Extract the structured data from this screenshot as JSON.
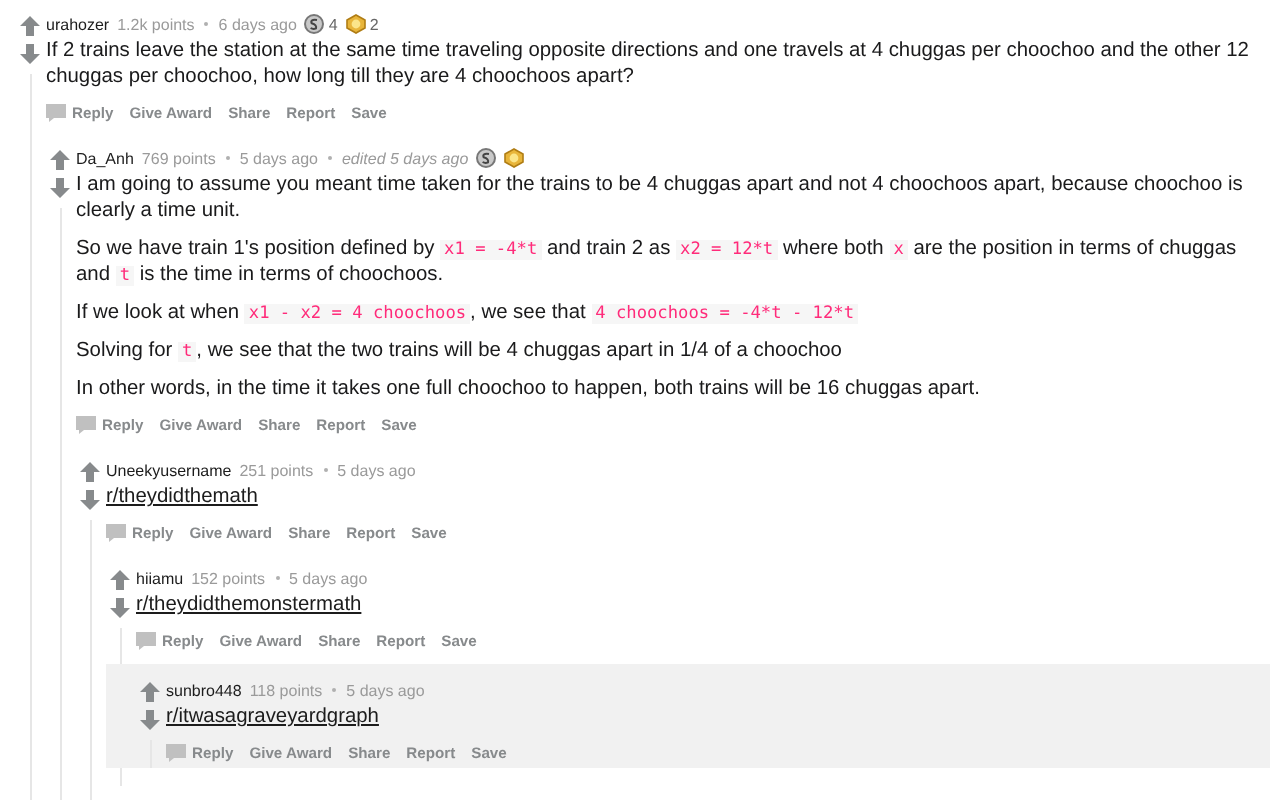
{
  "comments": [
    {
      "author": "urahozer",
      "points": "1.2k points",
      "time": "6 days ago",
      "highlighted": false,
      "awards": [
        {
          "kind": "silver",
          "count": "4"
        },
        {
          "kind": "gold",
          "count": "2"
        }
      ],
      "paragraphs": [
        [
          {
            "kind": "text",
            "text": "If 2 trains leave the station at the same time traveling opposite directions and one travels at 4 chuggas per choochoo and the other 12 chuggas per choochoo, how long till they are 4 choochoos apart?"
          }
        ]
      ],
      "actions": [
        {
          "kind": "reply",
          "label": "Reply"
        },
        {
          "kind": "plain",
          "label": "Give Award"
        },
        {
          "kind": "plain",
          "label": "Share"
        },
        {
          "kind": "plain",
          "label": "Report"
        },
        {
          "kind": "plain",
          "label": "Save"
        }
      ],
      "children": [
        {
          "author": "Da_Anh",
          "points": "769 points",
          "time": "5 days ago",
          "edited": "edited 5 days ago",
          "highlighted": false,
          "awards": [
            {
              "kind": "silver"
            },
            {
              "kind": "gold"
            }
          ],
          "paragraphs": [
            [
              {
                "kind": "text",
                "text": "I am going to assume you meant time taken for the trains to be 4 chuggas apart and not 4 choochoos apart, because choochoo is clearly a time unit."
              }
            ],
            [
              {
                "kind": "text",
                "text": "So we have train 1's position defined by "
              },
              {
                "kind": "code",
                "text": "x1 = -4*t"
              },
              {
                "kind": "text",
                "text": " and train 2 as "
              },
              {
                "kind": "code",
                "text": "x2 = 12*t"
              },
              {
                "kind": "text",
                "text": " where both "
              },
              {
                "kind": "code",
                "text": "x"
              },
              {
                "kind": "text",
                "text": " are the position in terms of chuggas and "
              },
              {
                "kind": "code",
                "text": "t"
              },
              {
                "kind": "text",
                "text": " is the time in terms of choochoos."
              }
            ],
            [
              {
                "kind": "text",
                "text": "If we look at when "
              },
              {
                "kind": "code",
                "text": "x1 - x2 = 4 choochoos"
              },
              {
                "kind": "text",
                "text": ", we see that "
              },
              {
                "kind": "code",
                "text": "4 choochoos = -4*t - 12*t"
              }
            ],
            [
              {
                "kind": "text",
                "text": "Solving for "
              },
              {
                "kind": "code",
                "text": "t"
              },
              {
                "kind": "text",
                "text": ", we see that the two trains will be 4 chuggas apart in 1/4 of a choochoo"
              }
            ],
            [
              {
                "kind": "text",
                "text": "In other words, in the time it takes one full choochoo to happen, both trains will be 16 chuggas apart."
              }
            ]
          ],
          "actions": [
            {
              "kind": "reply",
              "label": "Reply"
            },
            {
              "kind": "plain",
              "label": "Give Award"
            },
            {
              "kind": "plain",
              "label": "Share"
            },
            {
              "kind": "plain",
              "label": "Report"
            },
            {
              "kind": "plain",
              "label": "Save"
            }
          ],
          "children": [
            {
              "author": "Uneekyusername",
              "points": "251 points",
              "time": "5 days ago",
              "highlighted": false,
              "paragraphs": [
                [
                  {
                    "kind": "link",
                    "text": "r/theydidthemath"
                  }
                ]
              ],
              "actions": [
                {
                  "kind": "reply",
                  "label": "Reply"
                },
                {
                  "kind": "plain",
                  "label": "Give Award"
                },
                {
                  "kind": "plain",
                  "label": "Share"
                },
                {
                  "kind": "plain",
                  "label": "Report"
                },
                {
                  "kind": "plain",
                  "label": "Save"
                }
              ],
              "children": [
                {
                  "author": "hiiamu",
                  "points": "152 points",
                  "time": "5 days ago",
                  "highlighted": false,
                  "paragraphs": [
                    [
                      {
                        "kind": "link",
                        "text": "r/theydidthemonstermath"
                      }
                    ]
                  ],
                  "actions": [
                    {
                      "kind": "reply",
                      "label": "Reply"
                    },
                    {
                      "kind": "plain",
                      "label": "Give Award"
                    },
                    {
                      "kind": "plain",
                      "label": "Share"
                    },
                    {
                      "kind": "plain",
                      "label": "Report"
                    },
                    {
                      "kind": "plain",
                      "label": "Save"
                    }
                  ],
                  "children": [
                    {
                      "author": "sunbro448",
                      "points": "118 points",
                      "time": "5 days ago",
                      "highlighted": true,
                      "paragraphs": [
                        [
                          {
                            "kind": "link",
                            "text": "r/itwasagraveyardgraph"
                          }
                        ]
                      ],
                      "actions": [
                        {
                          "kind": "reply",
                          "label": "Reply"
                        },
                        {
                          "kind": "plain",
                          "label": "Give Award"
                        },
                        {
                          "kind": "plain",
                          "label": "Share"
                        },
                        {
                          "kind": "plain",
                          "label": "Report"
                        },
                        {
                          "kind": "plain",
                          "label": "Save"
                        }
                      ]
                    }
                  ]
                }
              ]
            }
          ]
        }
      ]
    }
  ]
}
